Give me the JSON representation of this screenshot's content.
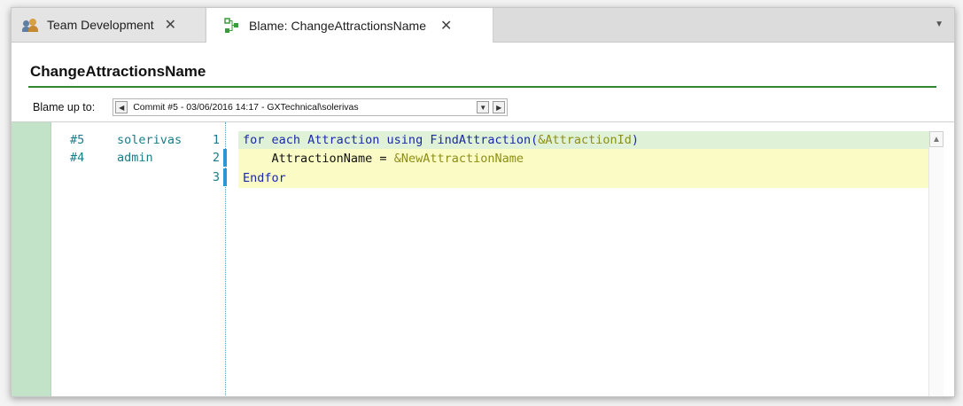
{
  "tabs": [
    {
      "label": "Team Development",
      "icon": "team-icon",
      "close": "✕"
    },
    {
      "label": "Blame: ChangeAttractionsName",
      "icon": "blame-icon",
      "close": "✕"
    }
  ],
  "tab_overflow": "▼",
  "document": {
    "title": "ChangeAttractionsName"
  },
  "blame": {
    "label": "Blame up to:",
    "selected_commit": "Commit #5 - 03/06/2016 14:17 - GXTechnical\\solerivas",
    "prev_button": "◀",
    "dropdown_button": "▼",
    "next_button": "▶"
  },
  "annotations": [
    {
      "commit": "#5",
      "author": "solerivas",
      "line": "1"
    },
    {
      "commit": "#4",
      "author": "admin",
      "line": "2"
    },
    {
      "commit": "",
      "author": "",
      "line": "3"
    }
  ],
  "code": {
    "line1": {
      "kw": "for each Attraction using FindAttraction(",
      "var": "&AttractionId",
      "end": ")"
    },
    "line2": {
      "indent": "    ",
      "plain": "AttractionName = ",
      "var": "&NewAttractionName"
    },
    "line3": {
      "kw": "Endfor"
    }
  },
  "scroll_up": "▲",
  "colors": {
    "rule": "#2f8a2f",
    "gutter": "#c2e3c8",
    "modified_line": "#fbfbc6",
    "current_line": "#dff1d7",
    "marker": "#2b97d6"
  }
}
